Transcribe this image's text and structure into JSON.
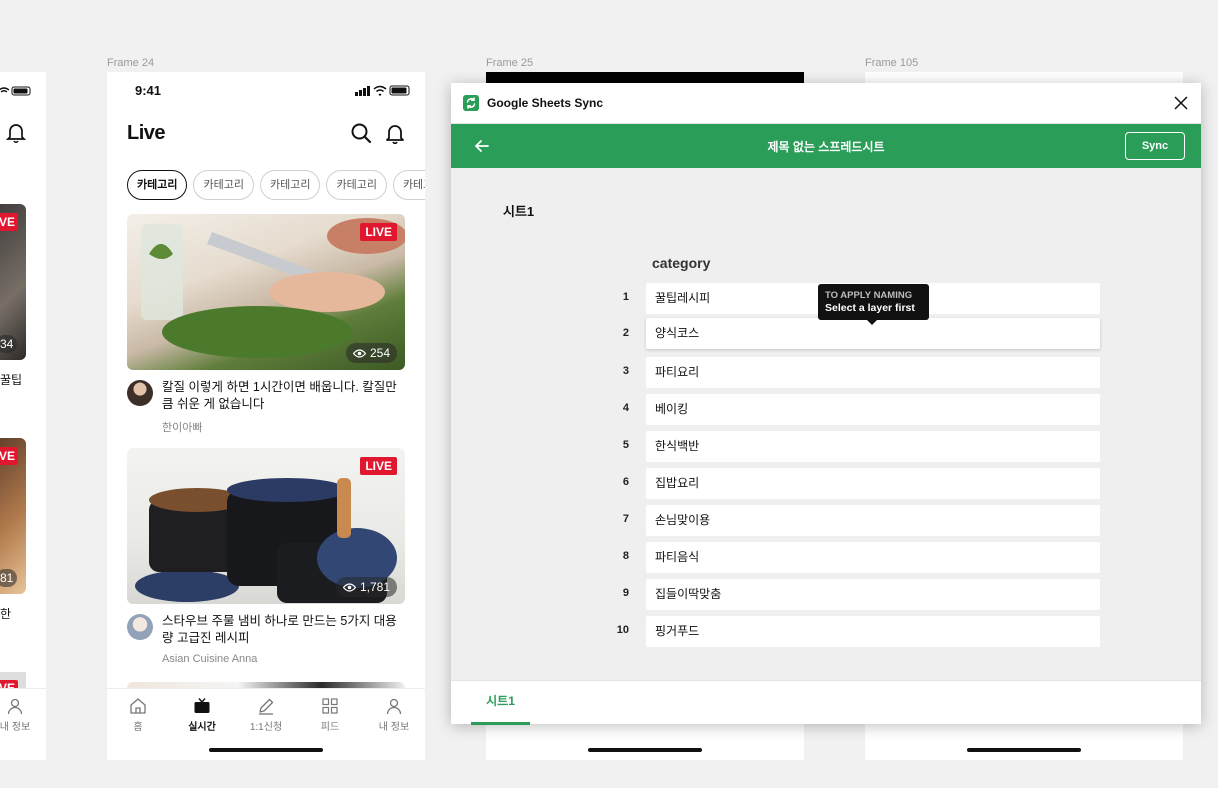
{
  "frames": {
    "frame24": "Frame 24",
    "frame25": "Frame 25",
    "frame105": "Frame 105"
  },
  "phone": {
    "time": "9:41",
    "app_title": "Live",
    "chips": [
      "카테고리",
      "카테고리",
      "카테고리",
      "카테고리",
      "카테고리"
    ],
    "cards": [
      {
        "live": "LIVE",
        "views": "254",
        "title": "칼질 이렇게 하면 1시간이면 배웁니다. 칼질만큼 쉬운 게 없습니다",
        "author": "한이아빠"
      },
      {
        "live": "LIVE",
        "views": "1,781",
        "title": "스타우브 주물 냄비 하나로 만드는 5가지 대용량 고급진 레시피",
        "author": "Asian Cuisine Anna"
      }
    ],
    "tabs": [
      "홈",
      "실시간",
      "1:1신청",
      "피드",
      "내 정보"
    ],
    "active_tab": "실시간"
  },
  "left_phone": {
    "live": "VE",
    "views_1": "34",
    "title_1": "꿀팁",
    "views_2": "81",
    "title_2": "한",
    "tab": "내 정보"
  },
  "plugin": {
    "name": "Google Sheets Sync",
    "sheet_title": "제목 없는 스프레드시트",
    "sync_label": "Sync",
    "sheet_name": "시트1",
    "column": "category",
    "rows": [
      {
        "n": "1",
        "v": "꿀팁레시피"
      },
      {
        "n": "2",
        "v": "양식코스"
      },
      {
        "n": "3",
        "v": "파티요리"
      },
      {
        "n": "4",
        "v": "베이킹"
      },
      {
        "n": "5",
        "v": "한식백반"
      },
      {
        "n": "6",
        "v": "집밥요리"
      },
      {
        "n": "7",
        "v": "손님맞이용"
      },
      {
        "n": "8",
        "v": "파티음식"
      },
      {
        "n": "9",
        "v": "집들이딱맞춤"
      },
      {
        "n": "10",
        "v": "핑거푸드"
      }
    ],
    "tooltip_line1": "TO APPLY NAMING",
    "tooltip_line2": "Select a layer first",
    "footer_tab": "시트1"
  },
  "colors": {
    "accent": "#2a9d58",
    "live": "#e0172f"
  }
}
